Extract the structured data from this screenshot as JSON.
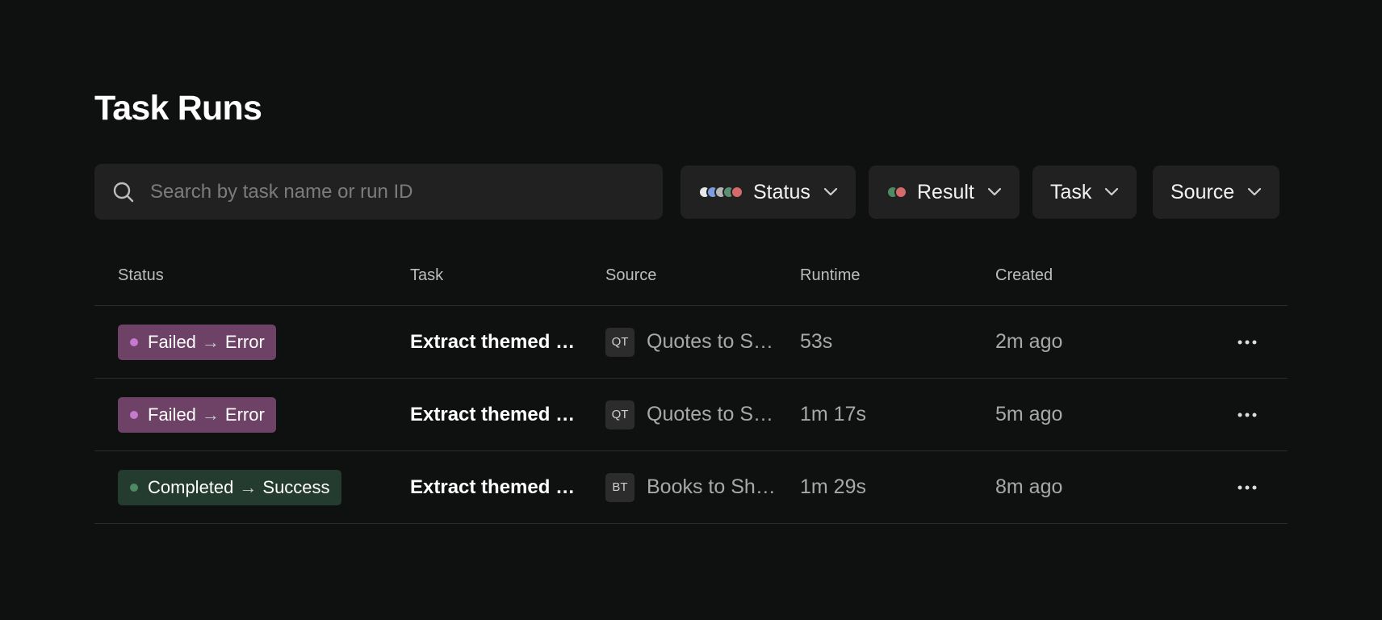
{
  "page": {
    "title": "Task Runs"
  },
  "search": {
    "placeholder": "Search by task name or run ID",
    "icon": "search-icon"
  },
  "filters": {
    "status": {
      "label": "Status",
      "dot_colors": [
        "#e8e8e8",
        "#7e9ce0",
        "#b7b7b7",
        "#5a9070",
        "#d46a6a"
      ]
    },
    "result": {
      "label": "Result",
      "dot_colors": [
        "#4e8a62",
        "#d46a6a"
      ]
    },
    "task": {
      "label": "Task"
    },
    "source": {
      "label": "Source"
    }
  },
  "table": {
    "headers": {
      "status": "Status",
      "task": "Task",
      "source": "Source",
      "runtime": "Runtime",
      "created": "Created"
    },
    "rows": [
      {
        "status": "Failed",
        "result": "Error",
        "status_color": "#c57ad0",
        "badge_bg": "#6d4266",
        "task": "Extract themed quotes",
        "source_abbr": "QT",
        "source": "Quotes to Sheets",
        "runtime": "53s",
        "created": "2m ago"
      },
      {
        "status": "Failed",
        "result": "Error",
        "status_color": "#c57ad0",
        "badge_bg": "#6d4266",
        "task": "Extract themed quotes",
        "source_abbr": "QT",
        "source": "Quotes to Sheets",
        "runtime": "1m 17s",
        "created": "5m ago"
      },
      {
        "status": "Completed",
        "result": "Success",
        "status_color": "#4e8a62",
        "badge_bg": "#243b30",
        "task": "Extract themed quotes",
        "source_abbr": "BT",
        "source": "Books to Sheets",
        "runtime": "1m 29s",
        "created": "8m ago"
      }
    ]
  }
}
